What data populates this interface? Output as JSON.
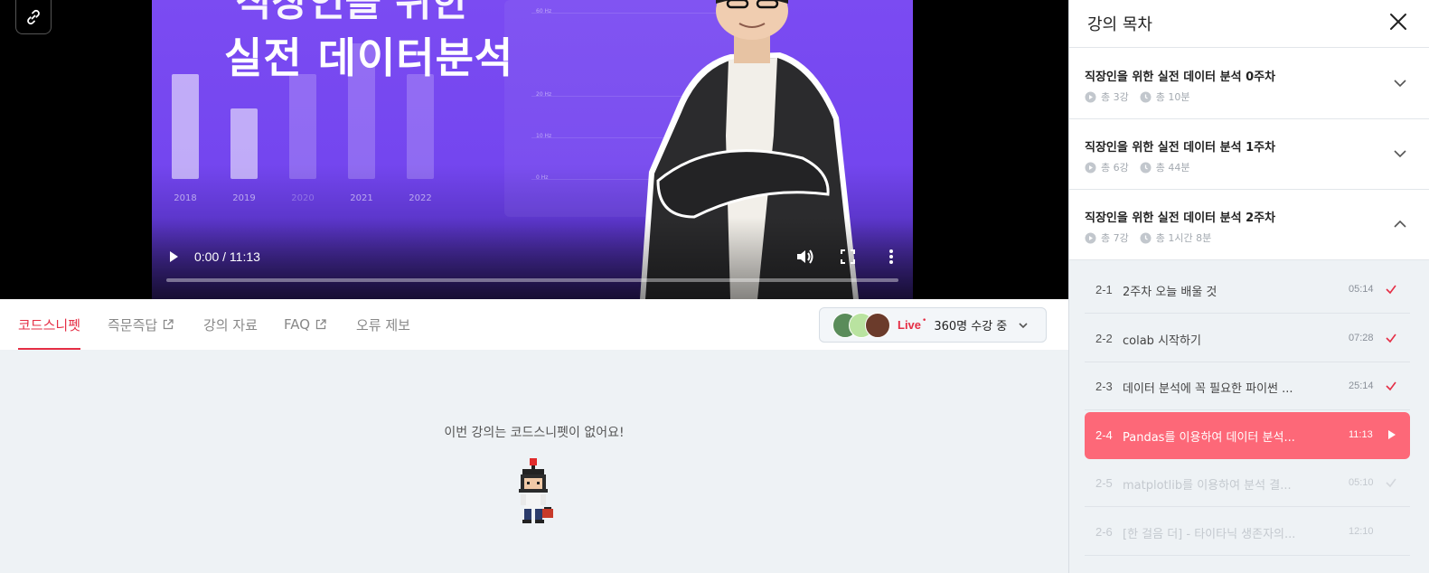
{
  "player": {
    "thumbnail_title_top": "직장인을 위한",
    "thumbnail_title_main": "실전 데이터분석",
    "chart_years": [
      "2018",
      "2019",
      "2020",
      "2021",
      "2022"
    ],
    "chart_hz": [
      "60 Hz",
      "20 Hz",
      "10 Hz",
      "0 Hz"
    ],
    "time": "0:00 / 11:13",
    "progress": 0,
    "play_icon": "play-icon",
    "volume_icon": "volume-icon",
    "fullscreen_icon": "fullscreen-icon",
    "more_icon": "more-vertical-icon",
    "link_icon": "link-icon"
  },
  "tabs": [
    {
      "label": "코드스니펫",
      "active": true
    },
    {
      "label": "즉문즉답",
      "external": true
    },
    {
      "label": "강의 자료"
    },
    {
      "label": "FAQ",
      "external": true
    },
    {
      "label": "오류 제보"
    }
  ],
  "live": {
    "label": "Live",
    "dot": "•",
    "viewers": "360명 수강 중"
  },
  "snippet": {
    "empty_message": "이번 강의는 코드스니펫이 없어요!"
  },
  "sidebar": {
    "title": "강의 목차",
    "weeks": [
      {
        "title": "직장인을 위한 실전 데이터 분석 0주차",
        "lectures": "총 3강",
        "duration": "총 10분",
        "expanded": false
      },
      {
        "title": "직장인을 위한 실전 데이터 분석 1주차",
        "lectures": "총 6강",
        "duration": "총 44분",
        "expanded": false
      },
      {
        "title": "직장인을 위한 실전 데이터 분석 2주차",
        "lectures": "총 7강",
        "duration": "총 1시간 8분",
        "expanded": true
      }
    ],
    "lessons": [
      {
        "num": "2-1",
        "title": "2주차 오늘 배울 것",
        "duration": "05:14",
        "status": "done"
      },
      {
        "num": "2-2",
        "title": "colab 시작하기",
        "duration": "07:28",
        "status": "done"
      },
      {
        "num": "2-3",
        "title": "데이터 분석에 꼭 필요한 파이썬 ...",
        "duration": "25:14",
        "status": "done"
      },
      {
        "num": "2-4",
        "title": "Pandas를 이용하여 데이터 분석...",
        "duration": "11:13",
        "status": "current"
      },
      {
        "num": "2-5",
        "title": "matplotlib를 이용하여 분석 결...",
        "duration": "05:10",
        "status": "locked"
      },
      {
        "num": "2-6",
        "title": "[한 걸음 더] - 타이타닉 생존자의...",
        "duration": "12:10",
        "status": "locked"
      }
    ]
  },
  "colors": {
    "accent": "#e52e45",
    "current_lesson": "#fd6878",
    "thumbnail_purple": "#7446ef",
    "panel_bg": "#eef2f5"
  }
}
